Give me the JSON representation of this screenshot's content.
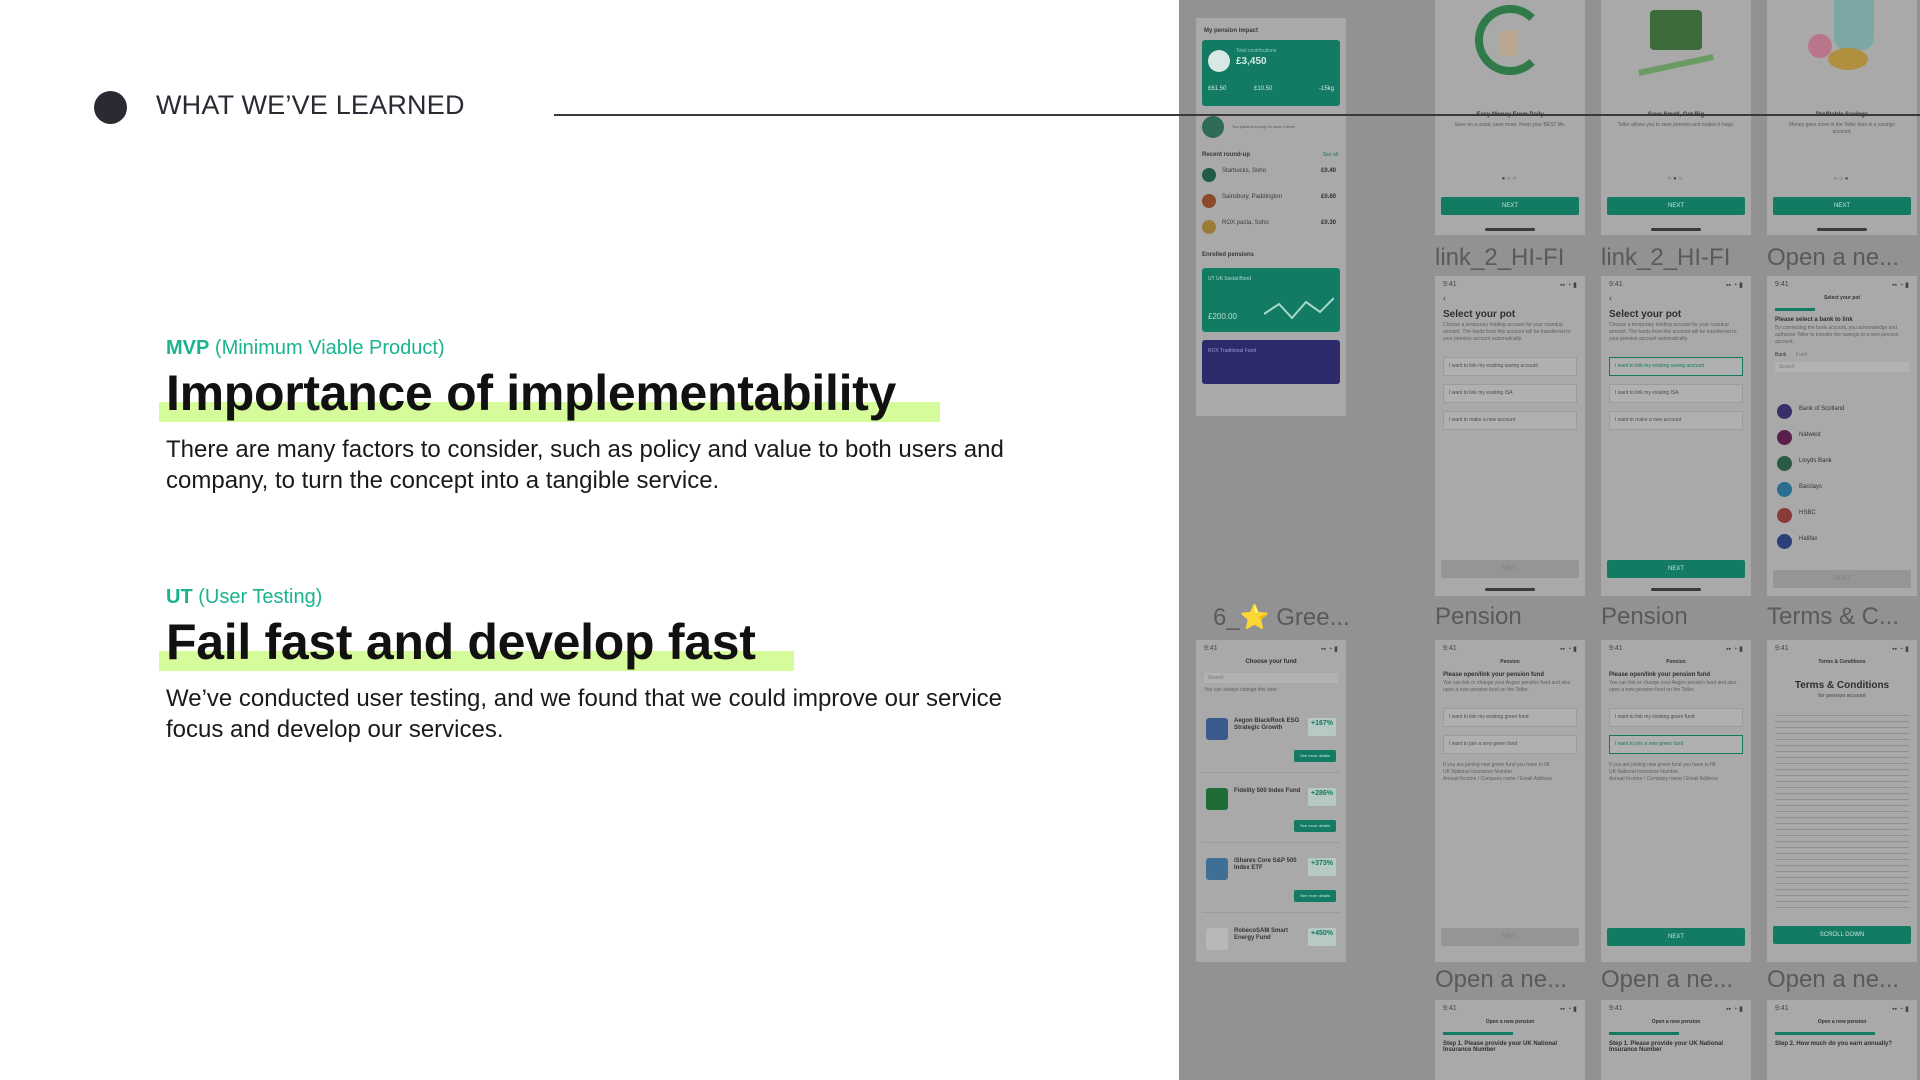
{
  "section": {
    "title": "WHAT WE’VE LEARNED"
  },
  "mvp": {
    "abbr": "MVP",
    "full": "(Minimum Viable Product)",
    "headline": "Importance of implementability",
    "body": "There are many factors to consider, such as policy and value to both users and company, to turn the concept into a tangible service."
  },
  "ut": {
    "abbr": "UT",
    "full": "(User Testing)",
    "headline": "Fail fast and develop fast",
    "body": "We’ve conducted user testing, and we found that we could improve our service focus and develop our services."
  },
  "mockups": {
    "status_time": "9:41",
    "home": {
      "section1": "My pension impact",
      "card_title": "Total contributions",
      "card_value": "£3,450",
      "stat1": "£61.50",
      "stat2": "£10.50",
      "stat3": "-15kg",
      "tree_note": "You planted enough to save 2 trees",
      "section2": "Recent round-up",
      "see_all": "See all",
      "rows": [
        {
          "name": "Starbucks, Soho",
          "value": "£0.40"
        },
        {
          "name": "Sainsbury, Paddington",
          "value": "£0.60"
        },
        {
          "name": "ROX pasta, Soho",
          "value": "£0.30"
        }
      ],
      "section3": "Enrolled pensions",
      "pension1": "UT UK Social Bond",
      "pension1_value": "£200.00",
      "pension2": "ROX Traditional Fund"
    },
    "onboarding": [
      {
        "title": "Easy Money From Daily",
        "sub": "Save on a usual, save more. Keep your BEST life."
      },
      {
        "title": "Save Small, Get Big",
        "sub": "Teller allows you to save pennies and makes it huge."
      },
      {
        "title": "Profitable Savings",
        "sub": "Money goes more in the Teller than in a savings account."
      }
    ],
    "next": "NEXT",
    "labels_row1": [
      "link_2_HI-FI",
      "link_2_HI-FI",
      "Open a ne..."
    ],
    "pot": {
      "title": "Select your pot",
      "sub": "Choose a temporary holding account for your roundup amount. The funds from this account will be transferred to your pension account automatically.",
      "options": [
        "I want to link my existing saving account",
        "I want to link my existing ISA",
        "I want to make a new account"
      ]
    },
    "bank": {
      "title": "Select your pot",
      "heading": "Please select a bank to link",
      "sub": "By connecting the bank account, you acknowledge and authorise Teller to transfer the savings to a new pension account.",
      "tab1": "Bank",
      "tab2": "Fund",
      "search": "Search",
      "banks": [
        "Bank of Scotland",
        "Natwest",
        "Lloyds Bank",
        "Barclays",
        "HSBC",
        "Halifax"
      ]
    },
    "labels_row2": [
      "6_⭐ Gree...",
      "Pension",
      "Pension",
      "Terms & C..."
    ],
    "fund": {
      "title": "Choose your fund",
      "search": "Search",
      "note": "You can always change this later.",
      "see_details": "See more details",
      "funds": [
        {
          "name": "Aegon BlackRock ESG Strategic Growth",
          "pct": "+167%"
        },
        {
          "name": "Fidelity 500 Index Fund",
          "pct": "+286%"
        },
        {
          "name": "iShares Core S&P 500 Index ETF",
          "pct": "+373%"
        },
        {
          "name": "RobecoSAM Smart Energy Fund",
          "pct": "+450%"
        }
      ]
    },
    "pension_link": {
      "nav": "Pension",
      "title": "Please open/link your pension fund",
      "sub": "You can link or change your Aegon pension fund and also open a new pension fund on the Teller.",
      "options": [
        "I want to link my existing green fund",
        "I want to join a new green fund"
      ],
      "note": "If you are joining new green fund you have to fill:",
      "bullets": [
        "UK National Insurance Number",
        "Annual Income / Company name / Email Address"
      ]
    },
    "terms": {
      "nav": "Terms & Conditions",
      "title": "Terms & Conditions",
      "sub": "for pension account",
      "button": "SCROLL DOWN"
    },
    "labels_row3": [
      "Open a ne...",
      "Open a ne...",
      "Open a ne..."
    ],
    "open_pension": {
      "nav": "Open a new pension",
      "step1": "Step 1. Please provide your UK National Insurance Number",
      "step2": "Step 2. How much do you earn annually?"
    }
  },
  "colors": {
    "accent_teal": "#19b48f",
    "highlight": "#d5fb9a",
    "overlay": "#929292",
    "app_green": "#137a63"
  }
}
